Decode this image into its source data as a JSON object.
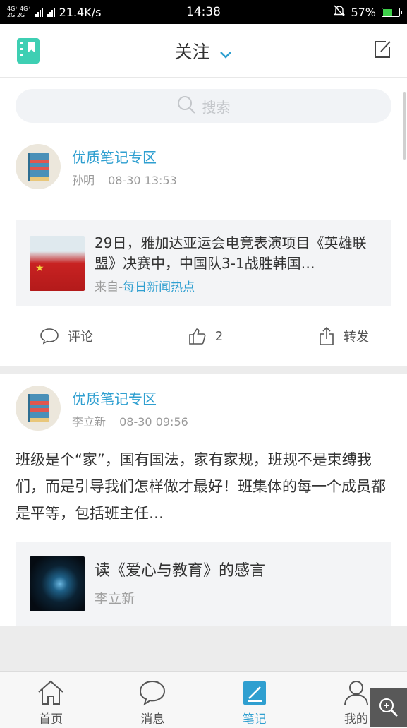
{
  "status_bar": {
    "network_top": "4G⁺ 4G⁺",
    "network_bottom": "2G  2G",
    "speed": "21.4K/s",
    "time": "14:38",
    "battery_percent": "57%",
    "battery_level": 0.57
  },
  "header": {
    "title": "关注"
  },
  "search": {
    "placeholder": "搜索"
  },
  "posts": [
    {
      "title": "优质笔记专区",
      "author": "孙明",
      "time": "08-30 13:53",
      "share_title": "29日，雅加达亚运会电竞表演项目《英雄联盟》决赛中，中国队3-1战胜韩国…",
      "share_source_prefix": "来自-",
      "share_source_name": "每日新闻热点",
      "actions": {
        "comment_label": "评论",
        "like_count": "2",
        "forward_label": "转发"
      }
    },
    {
      "title": "优质笔记专区",
      "author": "李立新",
      "time": "08-30 09:56",
      "body": "班级是个“家”，国有国法，家有家规，班规不是束缚我们，而是引导我们怎样做才最好！班集体的每一个成员都是平等，包括班主任…",
      "share_title": "读《爱心与教育》的感言",
      "share_source": "李立新"
    }
  ],
  "bottom_nav": {
    "items": [
      {
        "label": "首页",
        "icon": "home-icon"
      },
      {
        "label": "消息",
        "icon": "message-icon"
      },
      {
        "label": "笔记",
        "icon": "note-icon"
      },
      {
        "label": "我的",
        "icon": "profile-icon"
      }
    ],
    "active_index": 2
  },
  "colors": {
    "accent": "#2f9fd0",
    "logo": "#3ecfb3",
    "battery": "#3ed04a"
  }
}
